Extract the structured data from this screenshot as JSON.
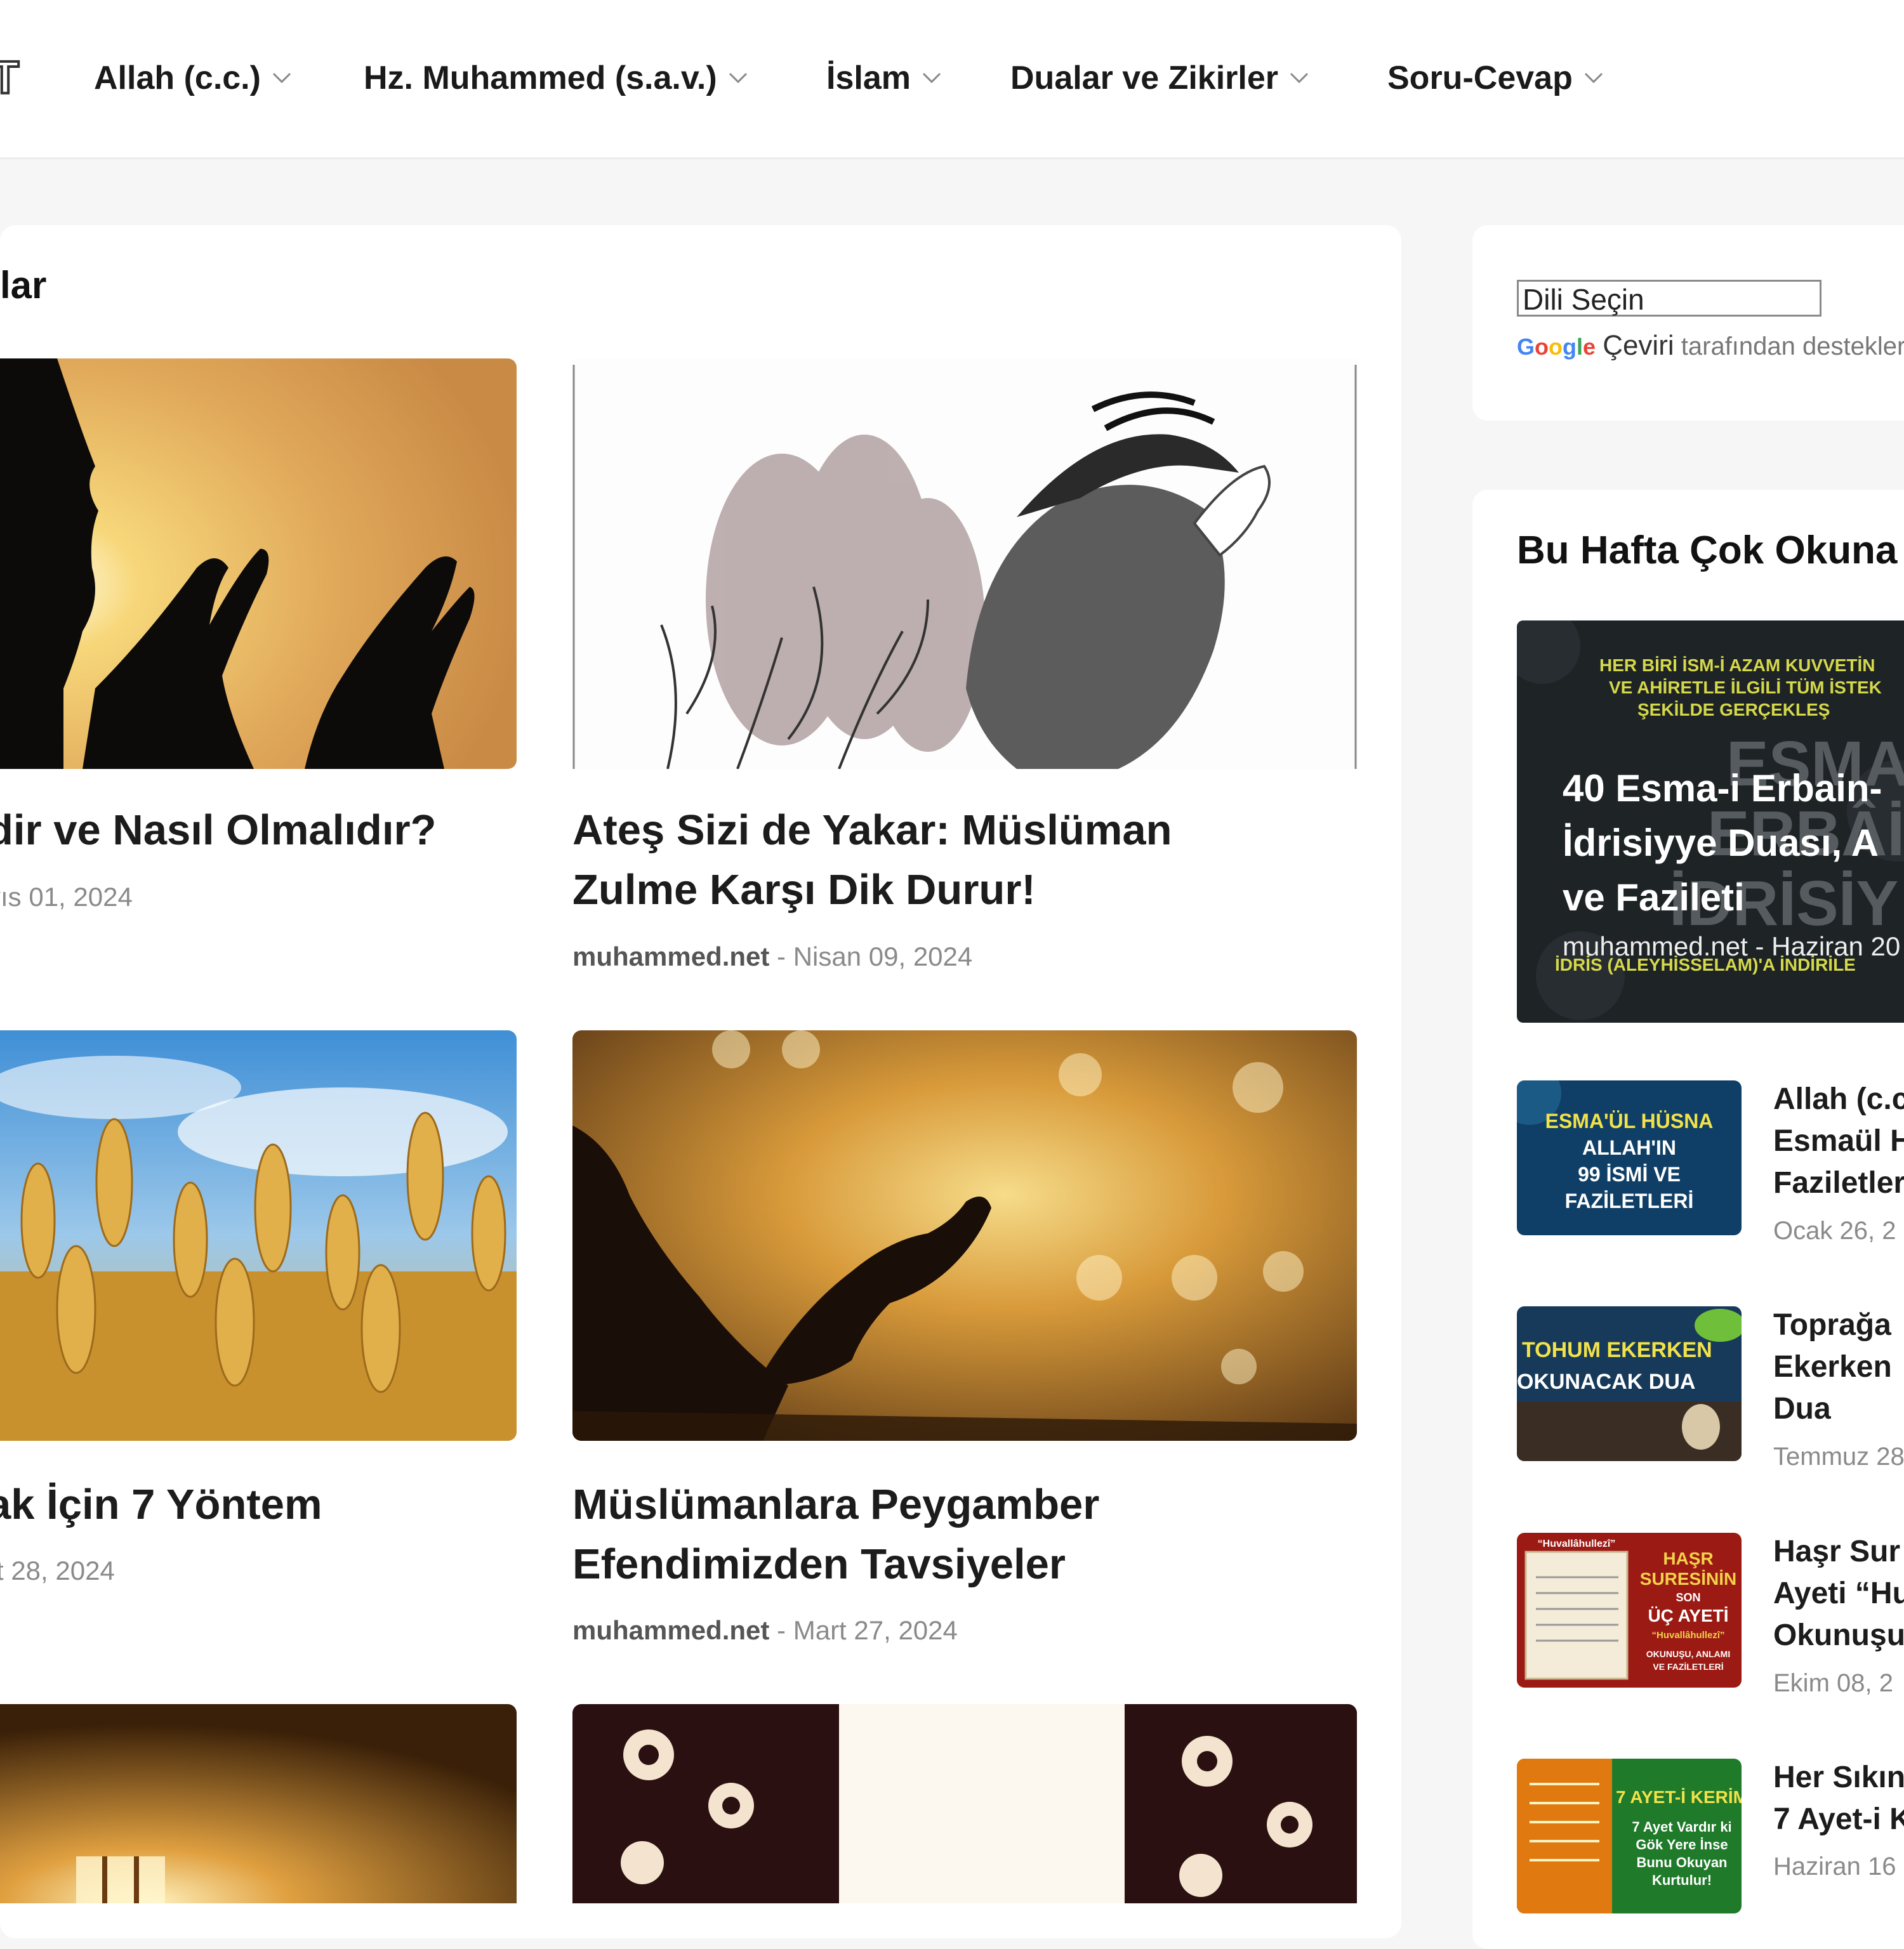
{
  "nav": {
    "items": [
      {
        "label": "Allah (c.c.)"
      },
      {
        "label": "Hz. Muhammed (s.a.v.)"
      },
      {
        "label": "İslam"
      },
      {
        "label": "Dualar ve Zikirler"
      },
      {
        "label": "Soru-Cevap"
      }
    ]
  },
  "main": {
    "section_title": "lar",
    "cards": [
      {
        "title_lines": [
          "dir ve Nasıl Olmalıdır?"
        ],
        "author": "",
        "date": "yıs 01, 2024"
      },
      {
        "title_lines": [
          "Ateş Sizi de Yakar: Müslüman",
          "Zulme Karşı Dik Durur!"
        ],
        "author": "muhammed.net",
        "date": "Nisan 09, 2024"
      },
      {
        "title_lines": [
          "ak İçin 7 Yöntem"
        ],
        "author": "",
        "date": "rt 28, 2024"
      },
      {
        "title_lines": [
          "Müslümanlara Peygamber",
          "Efendimizden Tavsiyeler"
        ],
        "author": "muhammed.net",
        "date": "Mart 27, 2024"
      }
    ],
    "meta_separator": " - "
  },
  "sidebar": {
    "translate": {
      "select_label": "Dili Seçin",
      "google": "Google",
      "ceviri": "Çeviri",
      "powered_suffix": "tarafından destekler"
    },
    "popular_title": "Bu Hafta Çok Okuna",
    "feature": {
      "title_lines": [
        "40 Esma-i Erbain-",
        "İdrisiyye Duası, A",
        "ve Fazileti"
      ],
      "meta": "muhammed.net - Haziran 20",
      "banner_lines": [
        "HER BİRİ İSM-İ AZAM KUVVETİN",
        "VE AHİRETLE İLGİLİ TÜM İSTEK",
        "ŞEKİLDE GERÇEKLEŞ",
        "ESMA-İ",
        "ERBÂİN",
        "İDRİSİY",
        "İDRİS (ALEYHİSSELAM)'A İNDİRİLE"
      ]
    },
    "popular": [
      {
        "title_lines": [
          "Allah (c.c",
          "Esmaül H",
          "Faziletler"
        ],
        "date": "Ocak 26, 2",
        "thumb_lines": [
          "ESMA'ÜL HÜSNA",
          "ALLAH'IN",
          "99 İSMİ VE",
          "FAZİLETLERİ"
        ]
      },
      {
        "title_lines": [
          "Toprağa",
          "Ekerken",
          "Dua"
        ],
        "date": "Temmuz 28",
        "thumb_lines": [
          "TOHUM EKERKEN",
          "OKUNACAK DUA"
        ]
      },
      {
        "title_lines": [
          "Haşr Sur",
          "Ayeti “Hu",
          "Okunuşu"
        ],
        "date": "Ekim 08, 2",
        "thumb_lines": [
          "“Huvallâhullezî”",
          "HAŞR",
          "SURESİNİN",
          "SON",
          "ÜÇ AYETİ",
          "“Huvallâhullezî”",
          "OKUNUŞU, ANLAMI",
          "VE FAZİLETLERİ"
        ]
      },
      {
        "title_lines": [
          "Her Sıkın",
          "7 Ayet-i K"
        ],
        "date": "Haziran 16",
        "thumb_lines": [
          "7 AYET-İ KERİM",
          "7 Ayet Vardır ki",
          "Gök Yere İnse",
          "Bunu Okuyan",
          "Kurtulur!"
        ]
      }
    ]
  }
}
